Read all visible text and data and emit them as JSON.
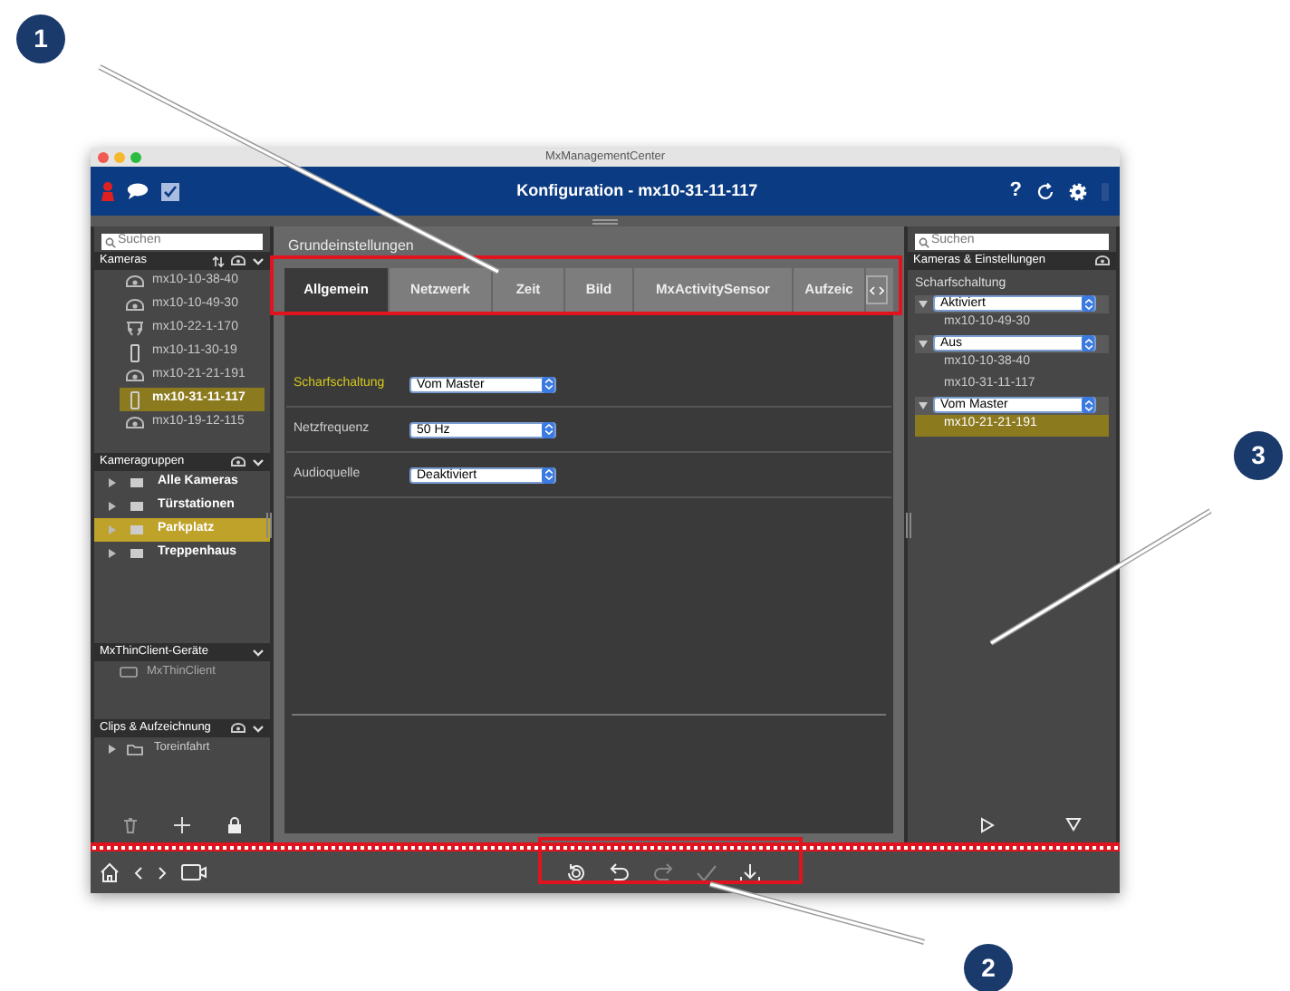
{
  "callouts": [
    {
      "number": "1"
    },
    {
      "number": "2"
    },
    {
      "number": "3"
    }
  ],
  "window": {
    "title": "MxManagementCenter"
  },
  "header": {
    "title": "Konfiguration - mx10-31-11-117",
    "help": "?"
  },
  "left_panel": {
    "search": {
      "placeholder": "Suchen"
    },
    "cameras": {
      "title": "Kameras",
      "items": [
        {
          "label": "mx10-10-38-40",
          "kind": "dome",
          "selected": false
        },
        {
          "label": "mx10-10-49-30",
          "kind": "dome",
          "selected": false
        },
        {
          "label": "mx10-22-1-170",
          "kind": "dual",
          "selected": false
        },
        {
          "label": "mx10-11-30-19",
          "kind": "tall",
          "selected": false
        },
        {
          "label": "mx10-21-21-191",
          "kind": "dome",
          "selected": false
        },
        {
          "label": "mx10-31-11-117",
          "kind": "tall",
          "selected": true
        },
        {
          "label": "mx10-19-12-115",
          "kind": "dome",
          "selected": false
        }
      ]
    },
    "camera_groups": {
      "title": "Kameragruppen",
      "items": [
        {
          "label": "Alle Kameras",
          "selected": false
        },
        {
          "label": "Türstationen",
          "selected": false
        },
        {
          "label": "Parkplatz",
          "selected": true
        },
        {
          "label": "Treppenhaus",
          "selected": false
        }
      ]
    },
    "thin_client": {
      "title": "MxThinClient-Geräte",
      "items": [
        "MxThinClient"
      ]
    },
    "clips": {
      "title": "Clips & Aufzeichnung",
      "items": [
        "Toreinfahrt"
      ]
    }
  },
  "center_panel": {
    "title": "Grundeinstellungen",
    "tabs": [
      {
        "label": "Allgemein",
        "selected": true
      },
      {
        "label": "Netzwerk",
        "selected": false
      },
      {
        "label": "Zeit",
        "selected": false
      },
      {
        "label": "Bild",
        "selected": false
      },
      {
        "label": "MxActivitySensor",
        "selected": false
      },
      {
        "label": "Aufzeic",
        "selected": false
      }
    ],
    "settings": [
      {
        "label": "Scharfschaltung",
        "value": "Vom Master",
        "highlighted": true
      },
      {
        "label": "Netzfrequenz",
        "value": "50 Hz",
        "highlighted": false
      },
      {
        "label": "Audioquelle",
        "value": "Deaktiviert",
        "highlighted": false
      }
    ]
  },
  "right_panel": {
    "search": {
      "placeholder": "Suchen"
    },
    "title": "Kameras & Einstellungen",
    "section": "Scharfschaltung",
    "groups": [
      {
        "value": "Aktiviert",
        "cameras": [
          {
            "label": "mx10-10-49-30",
            "selected": false
          }
        ]
      },
      {
        "value": "Aus",
        "cameras": [
          {
            "label": "mx10-10-38-40",
            "selected": false
          },
          {
            "label": "mx10-31-11-117",
            "selected": false
          }
        ]
      },
      {
        "value": "Vom Master",
        "cameras": [
          {
            "label": "mx10-21-21-191",
            "selected": true
          }
        ]
      }
    ]
  }
}
